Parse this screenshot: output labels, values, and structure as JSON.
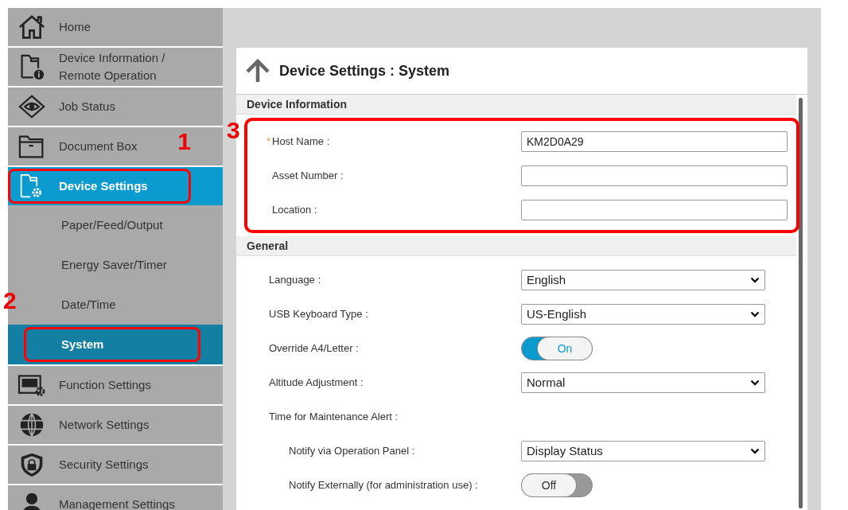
{
  "sidebar": {
    "items": [
      {
        "label": "Home",
        "selected": false,
        "highlighted": false
      },
      {
        "label": "Device Information / Remote Operation",
        "selected": false,
        "highlighted": false
      },
      {
        "label": "Job Status",
        "selected": false,
        "highlighted": false
      },
      {
        "label": "Document Box",
        "selected": false,
        "highlighted": false
      },
      {
        "label": "Device Settings",
        "selected": true,
        "highlighted": true,
        "callout": "1",
        "children": [
          {
            "label": "Paper/Feed/Output",
            "selected": false,
            "highlighted": false
          },
          {
            "label": "Energy Saver/Timer",
            "selected": false,
            "highlighted": false
          },
          {
            "label": "Date/Time",
            "selected": false,
            "highlighted": false
          },
          {
            "label": "System",
            "selected": true,
            "highlighted": true,
            "callout": "2"
          }
        ]
      },
      {
        "label": "Function Settings",
        "selected": false,
        "highlighted": false
      },
      {
        "label": "Network Settings",
        "selected": false,
        "highlighted": false
      },
      {
        "label": "Security Settings",
        "selected": false,
        "highlighted": false
      },
      {
        "label": "Management Settings",
        "selected": false,
        "highlighted": false
      }
    ]
  },
  "page": {
    "title": "Device Settings : System",
    "sections": [
      {
        "heading": "Device Information",
        "highlighted": true,
        "callout": "3",
        "rows": [
          {
            "kind": "text",
            "marker": "*",
            "label": "Host Name :",
            "value": "KM2D0A29"
          },
          {
            "kind": "text",
            "label": "Asset Number :",
            "value": ""
          },
          {
            "kind": "text",
            "label": "Location :",
            "value": ""
          }
        ]
      },
      {
        "heading": "General",
        "highlighted": false,
        "rows": [
          {
            "kind": "select",
            "label": "Language :",
            "value": "English"
          },
          {
            "kind": "select",
            "label": "USB Keyboard Type :",
            "value": "US-English"
          },
          {
            "kind": "toggle",
            "label": "Override A4/Letter :",
            "on": true,
            "text": "On"
          },
          {
            "kind": "select",
            "label": "Altitude Adjustment :",
            "value": "Normal"
          },
          {
            "kind": "heading",
            "label": "Time for Maintenance Alert :"
          },
          {
            "kind": "select",
            "label": "Notify via Operation Panel :",
            "value": "Display Status",
            "sub": true
          },
          {
            "kind": "toggle",
            "label": "Notify Externally (for administration use) :",
            "on": false,
            "text": "Off",
            "sub": true
          }
        ]
      }
    ]
  }
}
